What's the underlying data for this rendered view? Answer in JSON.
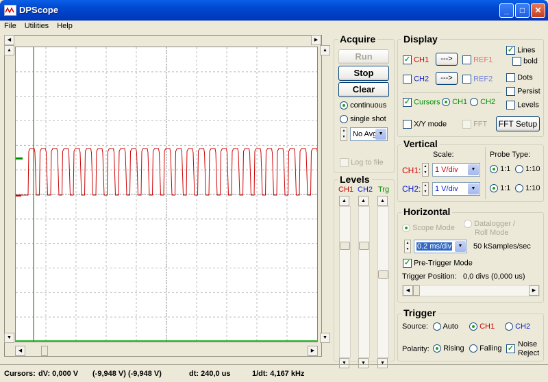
{
  "window": {
    "title": "DPScope",
    "minimize": "_",
    "maximize": "□",
    "close": "✕"
  },
  "menu": [
    "File",
    "Utilities",
    "Help"
  ],
  "acquire": {
    "title": "Acquire",
    "run": "Run",
    "stop": "Stop",
    "clear": "Clear",
    "continuous": "continuous",
    "single_shot": "single shot",
    "avg": "No Avg",
    "log": "Log to file"
  },
  "levels": {
    "title": "Levels",
    "ch1": "CH1",
    "ch2": "CH2",
    "trg": "Trg",
    "ch1_level": 0.25,
    "ch2_level": 0.25,
    "trg_level": 0.45
  },
  "display": {
    "title": "Display",
    "ch1": "CH1",
    "ch2": "CH2",
    "ref1": "REF1",
    "ref2": "REF2",
    "arrow_btn": "--->",
    "cursors": "Cursors",
    "cur_ch1": "CH1",
    "cur_ch2": "CH2",
    "xy": "X/Y mode",
    "fft": "FFT",
    "fft_setup": "FFT Setup",
    "lines": "Lines",
    "bold": "bold",
    "dots": "Dots",
    "persist": "Persist",
    "levels": "Levels"
  },
  "vertical": {
    "title": "Vertical",
    "scale": "Scale:",
    "probe": "Probe Type:",
    "ch1": "CH1:",
    "ch2": "CH2:",
    "ch1_scale": "1 V/div",
    "ch2_scale": "1 V/div",
    "p1": "1:1",
    "p10": "1:10"
  },
  "horizontal": {
    "title": "Horizontal",
    "scope_mode": "Scope Mode",
    "datalogger": "Datalogger /",
    "roll": "Roll Mode",
    "timebase": "0.2 ms/div",
    "samples": "50 kSamples/sec",
    "pretrigger": "Pre-Trigger Mode",
    "trig_pos_label": "Trigger Position:",
    "trig_pos": "0,0 divs (0,000 us)"
  },
  "trigger": {
    "title": "Trigger",
    "source": "Source:",
    "auto": "Auto",
    "ch1": "CH1",
    "ch2": "CH2",
    "polarity": "Polarity:",
    "rising": "Rising",
    "falling": "Falling",
    "noise": "Noise",
    "reject": "Reject"
  },
  "status": {
    "cursors": "Cursors:",
    "dv": "dV: 0,000 V",
    "pair": "(-9,948 V) (-9,948 V)",
    "dt": "dt: 240,0 us",
    "inv": "1/dt: 4,167 kHz"
  },
  "colors": {
    "ch1": "#d00000",
    "ch2": "#1020d0",
    "trg": "#009000",
    "cursor": "#00a000"
  },
  "waveform": {
    "pulses": 26,
    "high_level": "1 div above center",
    "low_level": "0.5 div below center"
  }
}
